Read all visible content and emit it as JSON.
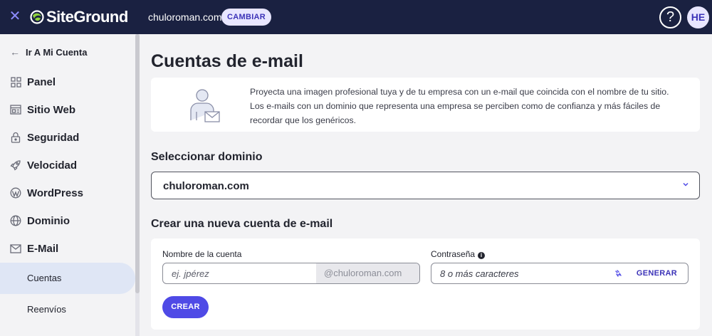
{
  "topbar": {
    "close_icon": "close-icon",
    "logo_text": "SiteGround",
    "domain": "chuloroman.com",
    "change_label": "CAMBIAR",
    "help_symbol": "?",
    "avatar_initials": "HE"
  },
  "sidebar": {
    "back_label": "Ir A Mi Cuenta",
    "items": [
      {
        "label": "Panel",
        "icon": "grid-icon"
      },
      {
        "label": "Sitio Web",
        "icon": "website-icon"
      },
      {
        "label": "Seguridad",
        "icon": "lock-icon"
      },
      {
        "label": "Velocidad",
        "icon": "rocket-icon"
      },
      {
        "label": "WordPress",
        "icon": "wordpress-icon"
      },
      {
        "label": "Dominio",
        "icon": "globe-icon"
      },
      {
        "label": "E-Mail",
        "icon": "mail-icon"
      }
    ],
    "subitems": [
      {
        "label": "Cuentas",
        "active": true
      },
      {
        "label": "Reenvíos",
        "active": false
      }
    ]
  },
  "main": {
    "title": "Cuentas de e-mail",
    "info_lines": [
      "Proyecta una imagen profesional tuya y de tu empresa con un e-mail que coincida con el nombre de tu sitio.",
      "Los e-mails con un dominio que representa una empresa se perciben como de confianza y más fáciles de",
      "recordar que los genéricos."
    ],
    "select_domain_title": "Seleccionar dominio",
    "selected_domain": "chuloroman.com",
    "create_title": "Crear una nueva cuenta de e-mail",
    "account_label": "Nombre de la cuenta",
    "account_placeholder": "ej. jpérez",
    "account_suffix": "@chuloroman.com",
    "password_label": "Contraseña",
    "password_placeholder": "8 o más caracteres",
    "generate_label": "GENERAR",
    "create_button": "CREAR"
  },
  "colors": {
    "topbar_bg": "#1a2141",
    "accent": "#4f4ae6",
    "active_item_bg": "#dfe6f5"
  }
}
